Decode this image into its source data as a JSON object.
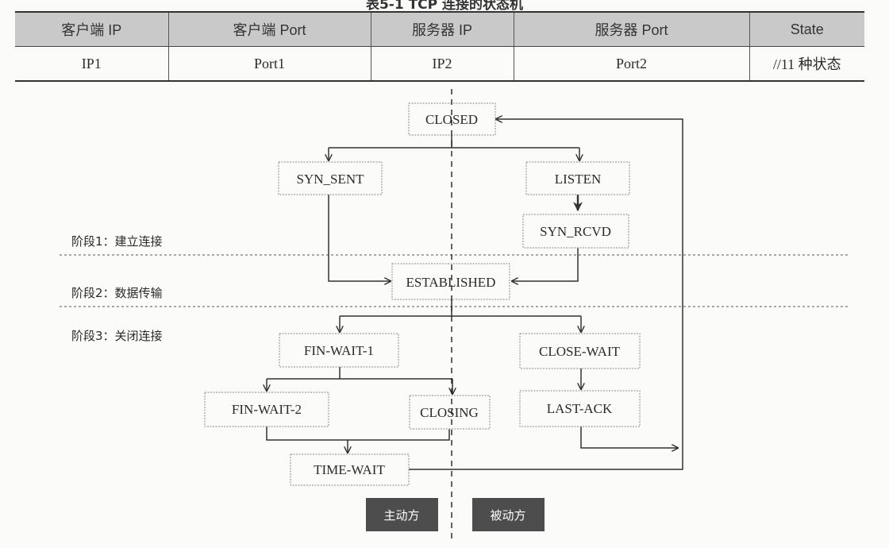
{
  "caption": "表5-1 TCP 连接的状态机",
  "table": {
    "headers": [
      "客户端 IP",
      "客户端 Port",
      "服务器 IP",
      "服务器 Port",
      "State"
    ],
    "rows": [
      [
        "IP1",
        "Port1",
        "IP2",
        "Port2",
        "//11 种状态"
      ]
    ]
  },
  "states": {
    "closed": "CLOSED",
    "syn_sent": "SYN_SENT",
    "listen": "LISTEN",
    "syn_rcvd": "SYN_RCVD",
    "established": "ESTABLISHED",
    "fin_wait_1": "FIN-WAIT-1",
    "close_wait": "CLOSE-WAIT",
    "fin_wait_2": "FIN-WAIT-2",
    "closing": "CLOSING",
    "last_ack": "LAST-ACK",
    "time_wait": "TIME-WAIT"
  },
  "stages": {
    "stage1": "阶段1：建立连接",
    "stage2": "阶段2：数据传输",
    "stage3": "阶段3：关闭连接"
  },
  "roles": {
    "active": "主动方",
    "passive": "被动方"
  },
  "colors": {
    "role_label_bg": "#4d4d4d",
    "header_bg": "#c9c9c9",
    "line": "#333333"
  }
}
